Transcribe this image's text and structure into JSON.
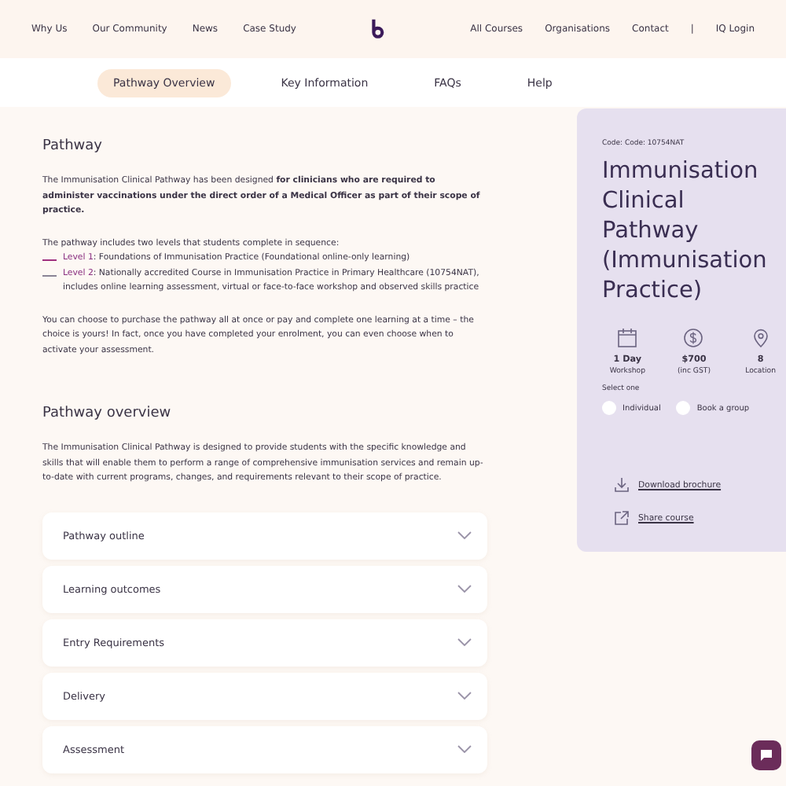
{
  "nav": {
    "left": [
      "Why Us",
      "Our Community",
      "News",
      "Case Study"
    ],
    "right": [
      "All Courses",
      "Organisations",
      "Contact"
    ],
    "separator": "|",
    "login": "IQ Login"
  },
  "tabs": [
    {
      "label": "Pathway Overview",
      "selected": true
    },
    {
      "label": "Key Information",
      "selected": false
    },
    {
      "label": "FAQs",
      "selected": false
    },
    {
      "label": "Help",
      "selected": false
    }
  ],
  "pathway": {
    "title": "Pathway",
    "intro": "The Immunisation Clinical Pathway has been designed **for clinicians who are required to administer vaccinations under the direct order of a Medical Officer as part of their scope of practice.**",
    "sequence_intro": "The pathway includes two levels that students complete in sequence:",
    "levels": [
      {
        "label": "Level 1",
        "text": ": Foundations of Immunisation Practice (Foundational online-only learning)",
        "selected": true
      },
      {
        "label": "Level 2",
        "text": ": Nationally accredited Course in Immunisation Practice in Primary Healthcare (10754NAT), includes online learning assessment, virtual or face-to-face workshop and observed skills practice",
        "selected": false
      }
    ],
    "closing": "You can choose to purchase the pathway all at once or pay and complete one learning at a time – the choice is yours! In fact, once you have completed your enrolment, you can even choose when to activate your assessment."
  },
  "overview": {
    "title": "Pathway overview",
    "text": "The Immunisation Clinical Pathway is designed to provide students with the specific knowledge and skills that will enable them to perform a range of comprehensive immunisation services and remain up-to-date with current programs, changes, and requirements relevant to their scope of practice."
  },
  "accordion": [
    {
      "label": "Pathway outline",
      "expanded": false
    },
    {
      "label": "Learning outcomes",
      "expanded": false
    },
    {
      "label": "Entry Requirements",
      "expanded": false
    },
    {
      "label": "Delivery",
      "expanded": false
    },
    {
      "label": "Assessment",
      "expanded": false
    }
  ],
  "card": {
    "code": "Code: Code: 10754NAT",
    "title": "Immunisation Clinical Pathway (Immunisation Practice)",
    "stats": [
      {
        "kind": "calendar",
        "value": "1 Day",
        "label": "Workshop"
      },
      {
        "kind": "price",
        "value": "$700",
        "label": "(inc GST)"
      },
      {
        "kind": "location",
        "value": "8",
        "label": "Location"
      }
    ],
    "select_label": "Select one",
    "options": [
      {
        "label": "Individual",
        "selected": false
      },
      {
        "label": "Book a group",
        "selected": false
      }
    ],
    "links": [
      {
        "kind": "download",
        "label": "Download brochure"
      },
      {
        "kind": "share",
        "label": "Share course"
      }
    ]
  }
}
